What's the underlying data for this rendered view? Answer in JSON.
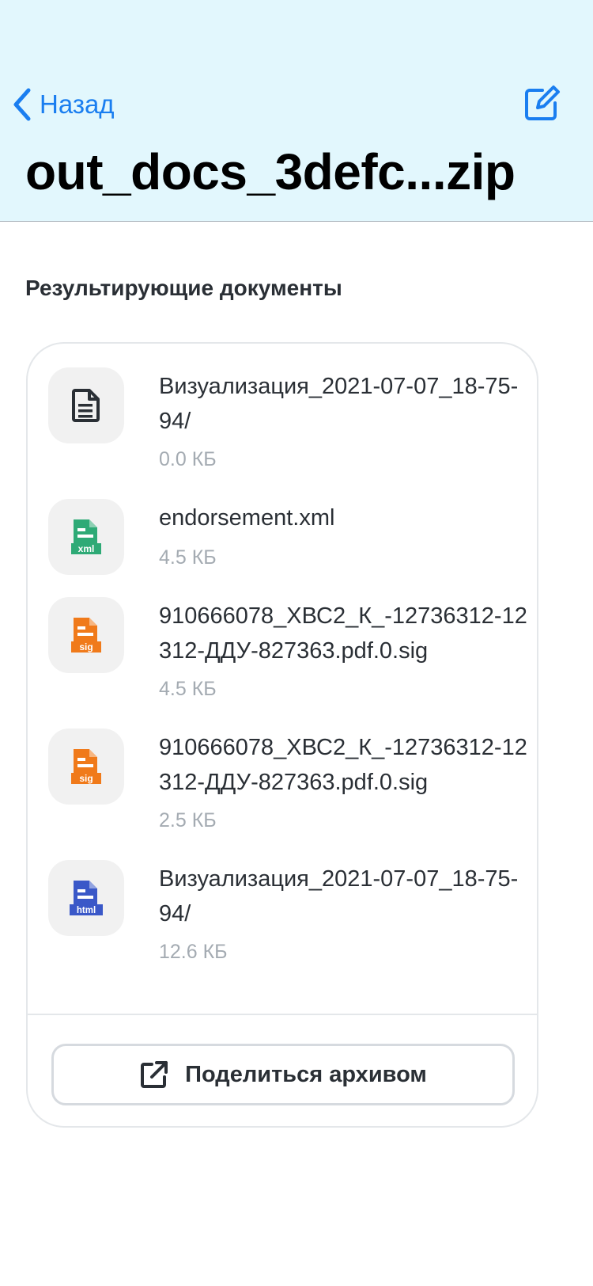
{
  "header": {
    "back_label": "Назад",
    "title": "out_docs_3defc...zip"
  },
  "section": {
    "title": "Результирующие документы"
  },
  "files": [
    {
      "name": "Визуализация_2021-07-07_18-75-94/",
      "size": "0.0 КБ",
      "type": "folder",
      "icon": "document-icon"
    },
    {
      "name": "endorsement.xml",
      "size": "4.5 КБ",
      "type": "xml",
      "icon_label": "xml",
      "color": "#2eaa76"
    },
    {
      "name": "910666078_ХВС2_К_-12736312-12312-ДДУ-827363.pdf.0.sig",
      "size": "4.5 КБ",
      "type": "sig",
      "icon_label": "sig",
      "color": "#f07a1a"
    },
    {
      "name": "910666078_ХВС2_К_-12736312-12312-ДДУ-827363.pdf.0.sig",
      "size": "2.5 КБ",
      "type": "sig",
      "icon_label": "sig",
      "color": "#f07a1a"
    },
    {
      "name": "Визуализация_2021-07-07_18-75-94/",
      "size": "12.6 КБ",
      "type": "html",
      "icon_label": "html",
      "color": "#3a58c8"
    }
  ],
  "share": {
    "label": "Поделиться архивом"
  },
  "colors": {
    "header_bg": "#e2f7fd",
    "accent": "#1a7ef0"
  }
}
